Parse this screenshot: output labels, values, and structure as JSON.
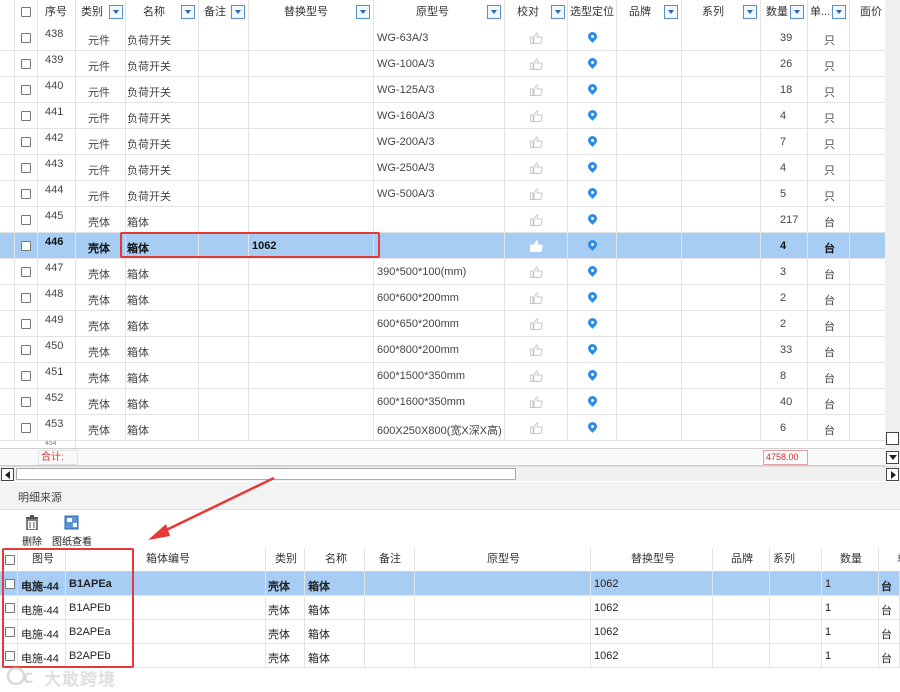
{
  "top_table": {
    "headers": {
      "seq": "序号",
      "category": "类别",
      "name": "名称",
      "remark": "备注",
      "replace_model": "替换型号",
      "orig_model": "原型号",
      "verify": "校对",
      "locate": "选型定位",
      "brand": "品牌",
      "series": "系列",
      "qty": "数量",
      "unit": "单...",
      "price": "面价"
    },
    "rows": [
      {
        "seq": "438",
        "category": "元件",
        "name": "负荷开关",
        "remark": "",
        "replace_model": "",
        "orig_model": "WG-63A/3",
        "qty": "39",
        "unit": "只"
      },
      {
        "seq": "439",
        "category": "元件",
        "name": "负荷开关",
        "remark": "",
        "replace_model": "",
        "orig_model": "WG-100A/3",
        "qty": "26",
        "unit": "只"
      },
      {
        "seq": "440",
        "category": "元件",
        "name": "负荷开关",
        "remark": "",
        "replace_model": "",
        "orig_model": "WG-125A/3",
        "qty": "18",
        "unit": "只"
      },
      {
        "seq": "441",
        "category": "元件",
        "name": "负荷开关",
        "remark": "",
        "replace_model": "",
        "orig_model": "WG-160A/3",
        "qty": "4",
        "unit": "只"
      },
      {
        "seq": "442",
        "category": "元件",
        "name": "负荷开关",
        "remark": "",
        "replace_model": "",
        "orig_model": "WG-200A/3",
        "qty": "7",
        "unit": "只"
      },
      {
        "seq": "443",
        "category": "元件",
        "name": "负荷开关",
        "remark": "",
        "replace_model": "",
        "orig_model": "WG-250A/3",
        "qty": "4",
        "unit": "只"
      },
      {
        "seq": "444",
        "category": "元件",
        "name": "负荷开关",
        "remark": "",
        "replace_model": "",
        "orig_model": "WG-500A/3",
        "qty": "5",
        "unit": "只"
      },
      {
        "seq": "445",
        "category": "壳体",
        "name": "箱体",
        "remark": "",
        "replace_model": "",
        "orig_model": "",
        "qty": "217",
        "unit": "台"
      },
      {
        "seq": "446",
        "category": "壳体",
        "name": "箱体",
        "remark": "",
        "replace_model": "1062",
        "orig_model": "",
        "qty": "4",
        "unit": "台",
        "selected": true
      },
      {
        "seq": "447",
        "category": "壳体",
        "name": "箱体",
        "remark": "",
        "replace_model": "",
        "orig_model": "390*500*100(mm)",
        "qty": "3",
        "unit": "台"
      },
      {
        "seq": "448",
        "category": "壳体",
        "name": "箱体",
        "remark": "",
        "replace_model": "",
        "orig_model": "600*600*200mm",
        "qty": "2",
        "unit": "台"
      },
      {
        "seq": "449",
        "category": "壳体",
        "name": "箱体",
        "remark": "",
        "replace_model": "",
        "orig_model": "600*650*200mm",
        "qty": "2",
        "unit": "台"
      },
      {
        "seq": "450",
        "category": "壳体",
        "name": "箱体",
        "remark": "",
        "replace_model": "",
        "orig_model": "600*800*200mm",
        "qty": "33",
        "unit": "台"
      },
      {
        "seq": "451",
        "category": "壳体",
        "name": "箱体",
        "remark": "",
        "replace_model": "",
        "orig_model": "600*1500*350mm",
        "qty": "8",
        "unit": "台"
      },
      {
        "seq": "452",
        "category": "壳体",
        "name": "箱体",
        "remark": "",
        "replace_model": "",
        "orig_model": "600*1600*350mm",
        "qty": "40",
        "unit": "台"
      },
      {
        "seq": "453",
        "category": "壳体",
        "name": "箱体",
        "remark": "",
        "replace_model": "",
        "orig_model": "600X250X800(宽X深X高)",
        "qty": "6",
        "unit": "台"
      }
    ],
    "footer": {
      "total_label": "合计:",
      "total_value": "4758.00"
    }
  },
  "detail": {
    "section_title": "明细来源",
    "toolbar": {
      "delete_label": "删除",
      "drawing_label": "图纸查看"
    },
    "headers": {
      "drawing_no": "图号",
      "box_no": "箱体编号",
      "category": "类别",
      "name": "名称",
      "remark": "备注",
      "orig_model": "原型号",
      "replace_model": "替换型号",
      "brand": "品牌",
      "series": "系列",
      "qty": "数量",
      "unit": "单"
    },
    "rows": [
      {
        "drawing_no": "电施-44",
        "box_no": "B1APEa",
        "category": "壳体",
        "name": "箱体",
        "replace_model": "1062",
        "qty": "1",
        "unit": "台",
        "selected": true
      },
      {
        "drawing_no": "电施-44",
        "box_no": "B1APEb",
        "category": "壳体",
        "name": "箱体",
        "replace_model": "1062",
        "qty": "1",
        "unit": "台"
      },
      {
        "drawing_no": "电施-44",
        "box_no": "B2APEa",
        "category": "壳体",
        "name": "箱体",
        "replace_model": "1062",
        "qty": "1",
        "unit": "台"
      },
      {
        "drawing_no": "电施-44",
        "box_no": "B2APEb",
        "category": "壳体",
        "name": "箱体",
        "replace_model": "1062",
        "qty": "1",
        "unit": "台"
      }
    ]
  },
  "watermark": "大敢跨境",
  "colors": {
    "selected_row": "#a7cdf4",
    "highlight_box": "#e53935",
    "arrow": "#e53935",
    "pin": "#2f8ae5",
    "total_text": "#d32f2f"
  }
}
